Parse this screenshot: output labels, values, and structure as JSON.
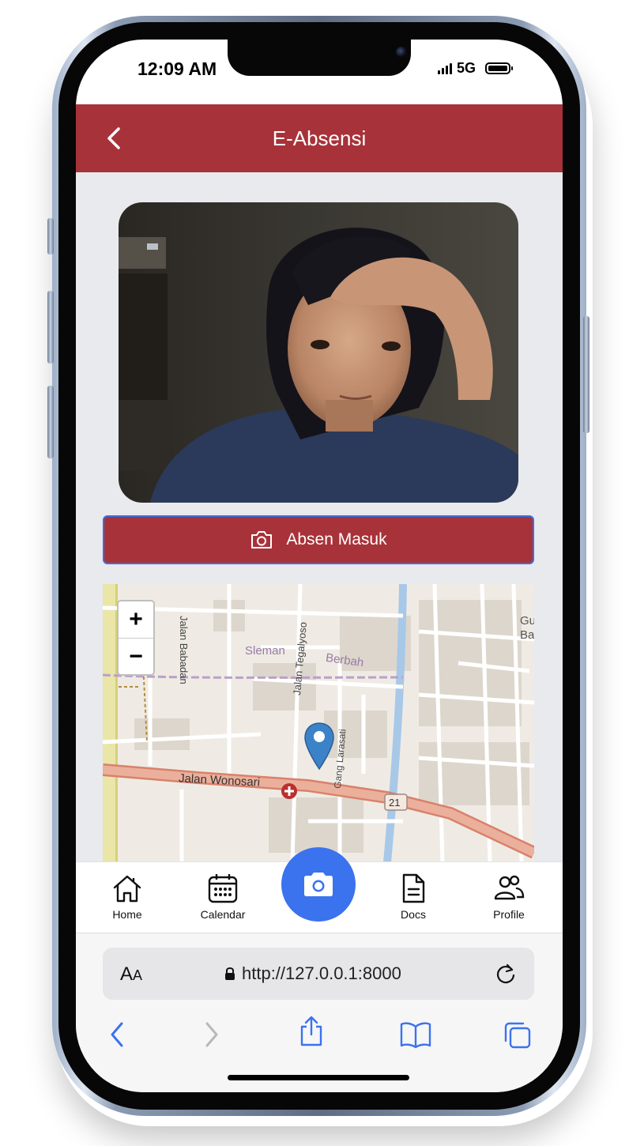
{
  "status_bar": {
    "time": "12:09 AM",
    "network": "5G"
  },
  "header": {
    "title": "E-Absensi"
  },
  "main": {
    "absen_button_label": "Absen Masuk"
  },
  "map": {
    "zoom_in": "+",
    "zoom_out": "−",
    "labels": {
      "road_main": "Jalan Wonosari",
      "road_babadan": "Jalan Babadan",
      "road_tegalyoso": "Jalan Tegalyoso",
      "road_larasati": "Gang Larasati",
      "area_sleman": "Sleman",
      "area_berbah": "Berbah",
      "route_number": "21",
      "edge_text_1": "Gu",
      "edge_text_2": "Ba"
    }
  },
  "bottom_nav": {
    "items": [
      {
        "label": "Home",
        "icon": "home-icon"
      },
      {
        "label": "Calendar",
        "icon": "calendar-icon"
      },
      {
        "label": "Docs",
        "icon": "document-icon"
      },
      {
        "label": "Profile",
        "icon": "profile-icon"
      }
    ],
    "center_icon": "camera-icon"
  },
  "browser": {
    "aa_big": "A",
    "aa_small": "A",
    "url": "http://127.0.0.1:8000"
  },
  "colors": {
    "accent_red": "#a83239",
    "primary_blue": "#3b72ee",
    "background": "#e8eaee"
  }
}
